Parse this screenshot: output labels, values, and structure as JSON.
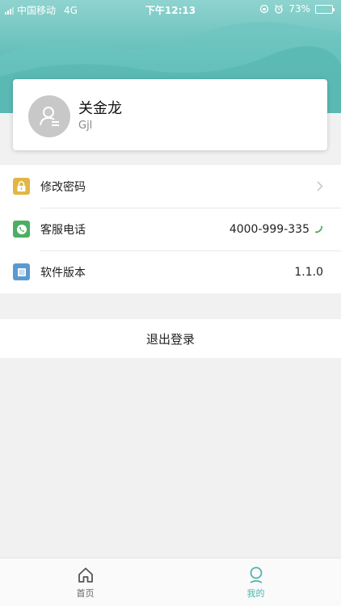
{
  "status_bar": {
    "carrier": "中国移动",
    "network": "4G",
    "time": "下午12:13",
    "battery": "73%",
    "battery_level": 0.73
  },
  "profile": {
    "name": "关金龙",
    "username": "Gjl"
  },
  "menu": {
    "items": [
      {
        "label": "修改密码",
        "icon": "lock-icon",
        "value": ""
      },
      {
        "label": "客服电话",
        "icon": "phone-icon",
        "value": "4000-999-335"
      },
      {
        "label": "软件版本",
        "icon": "app-version-icon",
        "value": "1.1.0"
      }
    ]
  },
  "logout": {
    "label": "退出登录"
  },
  "tabs": [
    {
      "label": "首页",
      "icon": "home-icon",
      "active": false
    },
    {
      "label": "我的",
      "icon": "profile-icon",
      "active": true
    }
  ],
  "colors": {
    "accent": "#4fb3ae",
    "lock_icon": "#e2b645",
    "phone_icon": "#4caf63",
    "version_icon": "#5b9ad1"
  }
}
